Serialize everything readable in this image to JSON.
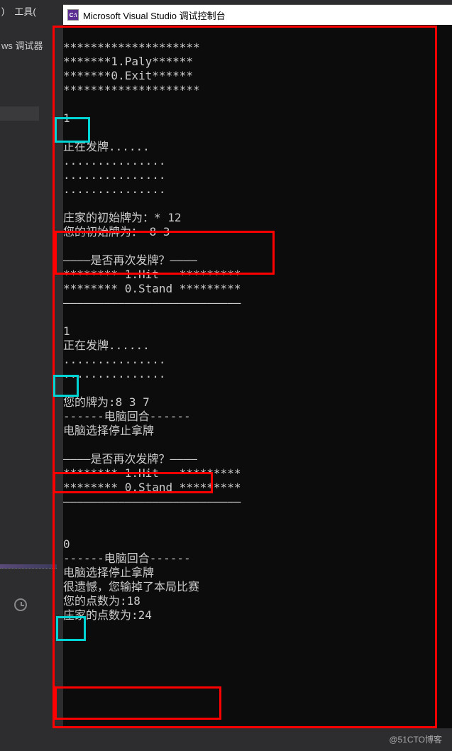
{
  "ide": {
    "menu_right": ")",
    "menu_tools": "工具(",
    "sub_debugger": "ws 调试器"
  },
  "window": {
    "title": "Microsoft Visual Studio 调试控制台",
    "icon_text": "C:\\"
  },
  "console": {
    "line1": "********************",
    "line2": "*******1.Paly******",
    "line3": "*******0.Exit******",
    "line4": "********************",
    "input1": "1",
    "dealing": "正在发牌......",
    "dots1": "...............",
    "dots2": "...............",
    "dots3": "...............",
    "dealer_init": "庄家的初始牌为：* 12",
    "player_init": "您的初始牌为： 8 3",
    "again_header": "————是否再次发牌？————",
    "hit_line": "******** 1.Hit   *********",
    "stand_line": "******** 0.Stand *********",
    "dash_line": "——————————————————————————",
    "input2": "1",
    "dealing2": "正在发牌......",
    "dots4": "...............",
    "dots5": "...............",
    "player_cards": "您的牌为:8 3 7",
    "cpu_turn_header": "------电脑回合------",
    "cpu_stop": "电脑选择停止拿牌",
    "again_header2": "————是否再次发牌？————",
    "hit_line2": "******** 1.Hit   *********",
    "stand_line2": "******** 0.Stand *********",
    "dash_line2": "——————————————————————————",
    "input3": "0",
    "cpu_turn_header2": "------电脑回合------",
    "cpu_stop2": "电脑选择停止拿牌",
    "lose_msg": "很遗憾，您输掉了本局比赛",
    "player_score": "您的点数为:18",
    "dealer_score": "庄家的点数为:24"
  },
  "watermark": "@51CTO博客"
}
